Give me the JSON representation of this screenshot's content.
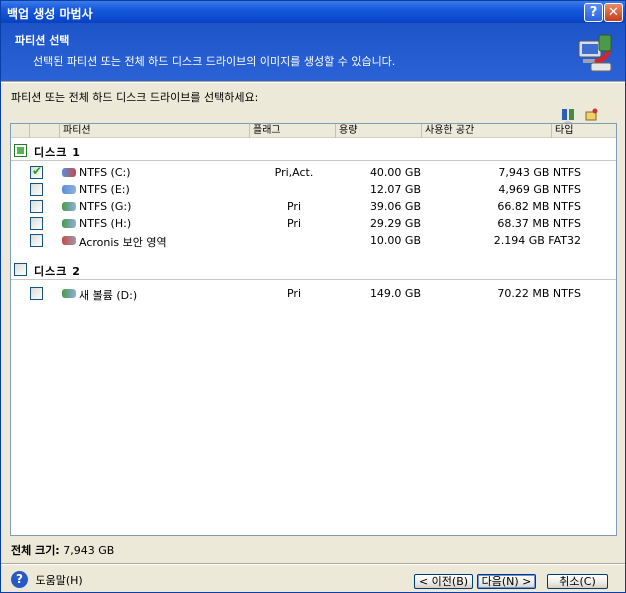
{
  "window": {
    "title": "백업 생성 마법사",
    "help_btn": "?",
    "close_btn": "✕"
  },
  "header": {
    "title": "파티션 선택",
    "subtitle": "선택된 파티션 또는 전체 하드 디스크 드라이브의 이미지를 생성할 수 있습니다."
  },
  "instruction": "파티션 또는 전체 하드 디스크 드라이브를 선택하세요:",
  "columns": {
    "partition": "파티션",
    "flags": "플래그",
    "capacity": "용량",
    "used": "사용한 공간",
    "type": "타입"
  },
  "disks": [
    {
      "label": "디스크 1",
      "partitions": [
        {
          "name": "NTFS (C:)",
          "flags": "Pri,Act.",
          "capacity": "40.00 GB",
          "used": "7,943 GB NTFS",
          "checked": true
        },
        {
          "name": "NTFS (E:)",
          "flags": "",
          "capacity": "12.07 GB",
          "used": "4,969 GB NTFS",
          "checked": false
        },
        {
          "name": "NTFS (G:)",
          "flags": "Pri",
          "capacity": "39.06 GB",
          "used": "66.82 MB NTFS",
          "checked": false
        },
        {
          "name": "NTFS (H:)",
          "flags": "Pri",
          "capacity": "29.29 GB",
          "used": "68.37 MB NTFS",
          "checked": false
        },
        {
          "name": "Acronis 보안 영역",
          "flags": "",
          "capacity": "10.00 GB",
          "used": "2.194 GB FAT32",
          "checked": false
        }
      ]
    },
    {
      "label": "디스크 2",
      "partitions": [
        {
          "name": "새 볼륨 (D:)",
          "flags": "Pri",
          "capacity": "149.0 GB",
          "used": "70.22 MB NTFS",
          "checked": false
        }
      ]
    }
  ],
  "total": {
    "label": "전체 크기:",
    "value": "7,943 GB"
  },
  "buttons": {
    "help": "도움말(H)",
    "prev": "< 이전(B)",
    "next": "다음(N) >",
    "cancel": "취소(C)"
  },
  "colors": {
    "titlebar": "#0a49cf",
    "header": "#2258cc",
    "check": "#21a121"
  },
  "icons": {
    "toolbar": [
      "sort-icon",
      "properties-icon",
      "info-icon"
    ]
  }
}
